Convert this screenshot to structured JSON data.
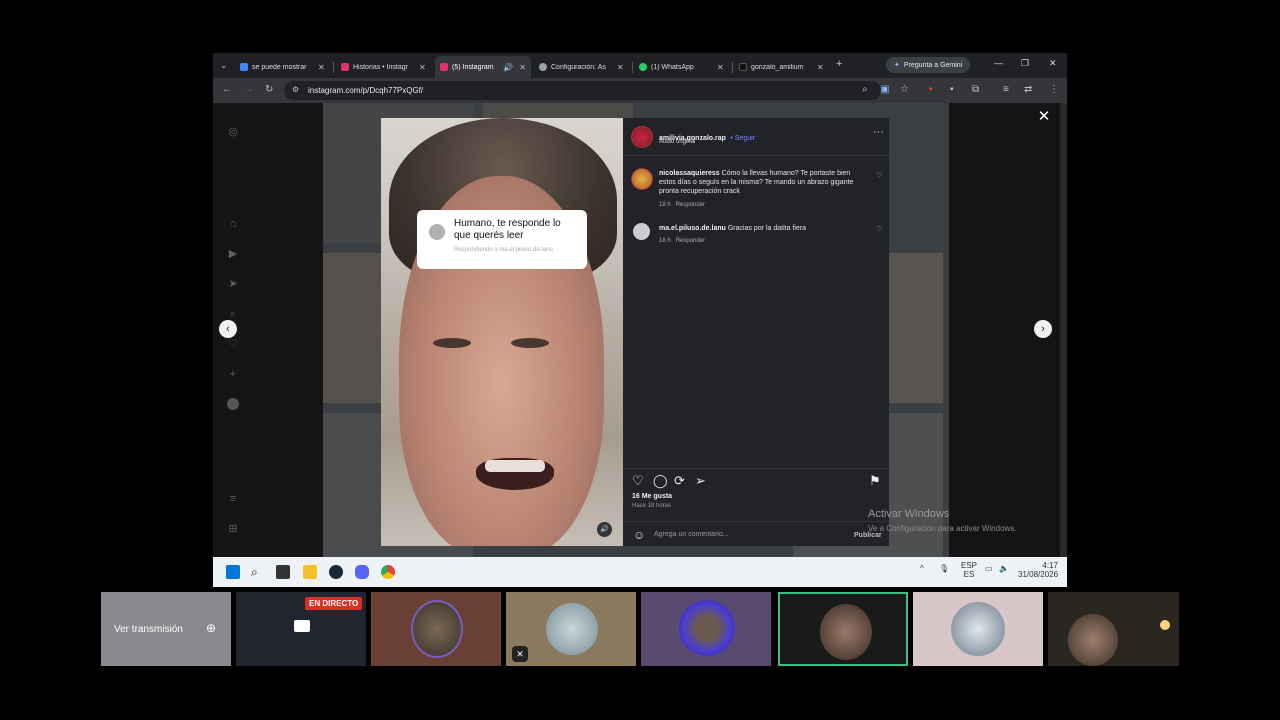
{
  "tabs": [
    {
      "title": "se puede mostrar",
      "color": "#4285f4",
      "active": false
    },
    {
      "title": "Historias • Instagr",
      "color": "#e1306c",
      "active": false
    },
    {
      "title": "(5) Instagram",
      "color": "#e1306c",
      "active": true
    },
    {
      "title": "Configuración: As",
      "color": "#9aa0a6",
      "active": false
    },
    {
      "title": "(1) WhatsApp",
      "color": "#25d366",
      "active": false
    },
    {
      "title": "gonzalo_amilium",
      "color": "#111",
      "active": false
    }
  ],
  "gemini_label": "Pregunta a Gemini",
  "url": "instagram.com/p/Dcqh77PxQGf/",
  "reel": {
    "bubble_text": "Humano, te responde lo que querés leer",
    "bubble_sub": "Respondiendo a ma.el.piluso.de.lanu"
  },
  "post": {
    "author": "amilivia.gonzalo.rap",
    "follow": "• Seguir",
    "audio": "Audio original",
    "comments": [
      {
        "user": "nicolassaquieress",
        "text": "Cómo la llevas humano? Te portaste bien estos días o seguís en la misma? Te mando un abrazo gigante pronta recuperación crack",
        "time": "18 h",
        "reply": "Responder"
      },
      {
        "user": "ma.el.piluso.de.lanu",
        "text": "Gracias por la datita fiera",
        "time": "18 h",
        "reply": "Responder"
      }
    ],
    "likes": "16 Me gusta",
    "posted": "Hace 18 horas",
    "comment_placeholder": "Agrega un comentario...",
    "publish": "Publicar"
  },
  "windows_activation": {
    "title": "Activar Windows",
    "sub": "Ve a Configuración para activar Windows."
  },
  "taskbar": {
    "lang": "ESP",
    "lang2": "ES",
    "time": "4:17",
    "date": "31/08/2026"
  },
  "meet": {
    "watch_stream": "Ver transmisión",
    "live_badge": "EN DIRECTO"
  }
}
